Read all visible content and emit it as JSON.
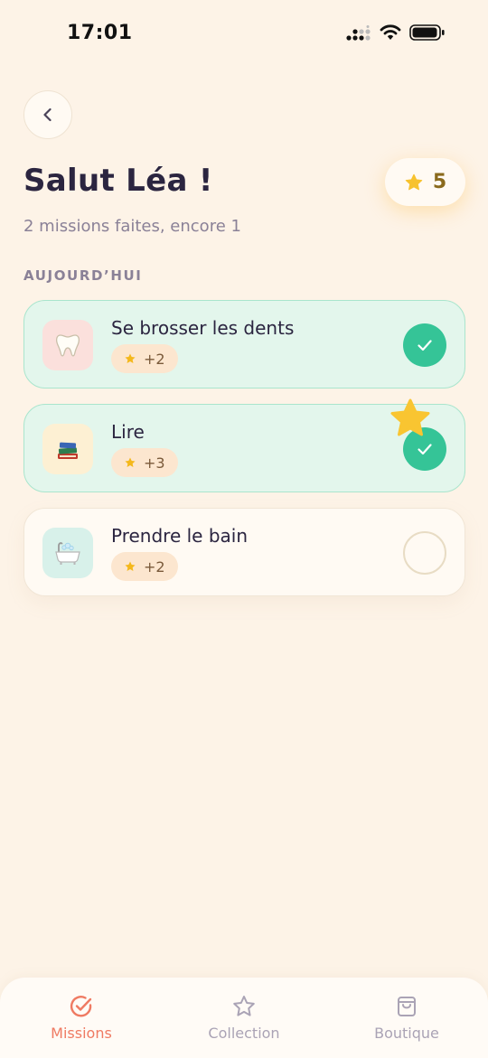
{
  "status_bar": {
    "time": "17:01"
  },
  "header": {
    "title": "Salut Léa !",
    "subtitle": "2 missions faites, encore 1",
    "star_count": "5"
  },
  "section": {
    "label": "AUJOURD’HUI"
  },
  "missions": [
    {
      "title": "Se brosser les dents",
      "reward": "+2",
      "icon": "tooth-icon",
      "done": true
    },
    {
      "title": "Lire",
      "reward": "+3",
      "icon": "books-icon",
      "done": true
    },
    {
      "title": "Prendre le bain",
      "reward": "+2",
      "icon": "bathtub-icon",
      "done": false
    }
  ],
  "tab_bar": {
    "tabs": [
      {
        "label": "Missions",
        "icon": "check-circle-icon",
        "active": true
      },
      {
        "label": "Collection",
        "icon": "star-outline-icon",
        "active": false
      },
      {
        "label": "Boutique",
        "icon": "shopping-bag-icon",
        "active": false
      }
    ]
  },
  "colors": {
    "background": "#fdf3e7",
    "done_card": "#e3f6ec",
    "check_green": "#35c497",
    "star_yellow": "#f7c22e",
    "active_tab": "#ef7a62"
  }
}
